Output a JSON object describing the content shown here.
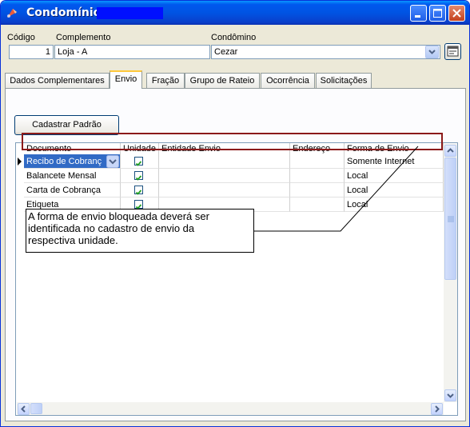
{
  "window": {
    "title": "Condomínio :",
    "title_redacted": true
  },
  "header": {
    "codigo_label": "Código",
    "complemento_label": "Complemento",
    "condominio_label": "Condômino",
    "codigo_value": "1",
    "complemento_value": "Loja - A",
    "condominio_value": "Cezar"
  },
  "tabs": [
    {
      "label": "Dados Complementares",
      "active": false
    },
    {
      "label": "Envio",
      "active": true
    },
    {
      "label": "Fração",
      "active": false
    },
    {
      "label": "Grupo de Rateio",
      "active": false
    },
    {
      "label": "Ocorrência",
      "active": false
    },
    {
      "label": "Solicitações",
      "active": false
    }
  ],
  "envio": {
    "default_button": "Cadastrar Padrão",
    "columns": [
      "Documento",
      "Unidade",
      "Entidade Envio",
      "Endereço",
      "Forma de Envio"
    ],
    "rows": [
      {
        "documento": "Recibo de Cobranç",
        "unidade": true,
        "entidade": "",
        "endereco": "",
        "forma": "Somente Internet"
      },
      {
        "documento": "Balancete Mensal",
        "unidade": true,
        "entidade": "",
        "endereco": "",
        "forma": "Local"
      },
      {
        "documento": "Carta de Cobrança",
        "unidade": true,
        "entidade": "",
        "endereco": "",
        "forma": "Local"
      },
      {
        "documento": "Etiqueta",
        "unidade": true,
        "entidade": "",
        "endereco": "",
        "forma": "Local"
      }
    ]
  },
  "annotation": {
    "line1": "A forma de envio bloqueada deverá ser",
    "line2": "identificada no cadastro de envio da",
    "line3": "respectiva unidade."
  },
  "colors": {
    "titlebar": "#0054e3",
    "highlight_box": "#8b1a1a",
    "selection": "#316ac5",
    "window_bg": "#ece9d8"
  }
}
